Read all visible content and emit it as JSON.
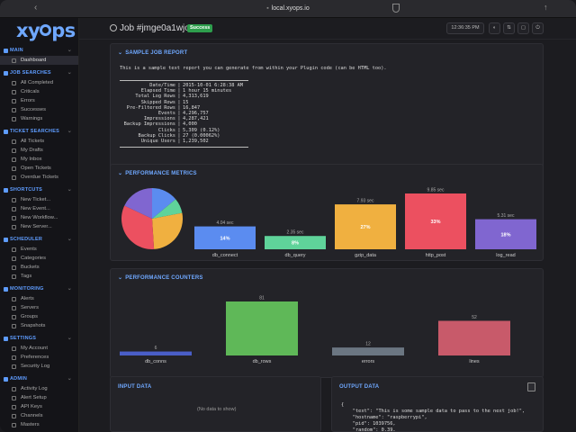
{
  "browser": {
    "url": "local.xyops.io"
  },
  "logo": {
    "prefix": "xy",
    "suffix": "ps"
  },
  "nav": [
    {
      "title": "MAIN",
      "items": [
        "Dashboard"
      ]
    },
    {
      "title": "JOB SEARCHES",
      "items": [
        "All Completed",
        "Criticals",
        "Errors",
        "Successes",
        "Warnings"
      ]
    },
    {
      "title": "TICKET SEARCHES",
      "items": [
        "All Tickets",
        "My Drafts",
        "My Inbox",
        "Open Tickets",
        "Overdue Tickets"
      ]
    },
    {
      "title": "SHORTCUTS",
      "items": [
        "New Ticket...",
        "New Event...",
        "New Workflow...",
        "New Server..."
      ]
    },
    {
      "title": "SCHEDULER",
      "items": [
        "Events",
        "Categories",
        "Buckets",
        "Tags"
      ]
    },
    {
      "title": "MONITORING",
      "items": [
        "Alerts",
        "Servers",
        "Groups",
        "Snapshots"
      ]
    },
    {
      "title": "SETTINGS",
      "items": [
        "My Account",
        "Preferences",
        "Security Log"
      ]
    },
    {
      "title": "ADMIN",
      "items": [
        "Activity Log",
        "Alert Setup",
        "API Keys",
        "Channels",
        "Masters"
      ]
    }
  ],
  "header": {
    "title": "Job #jmge0a1wjor",
    "status": "Success",
    "time": "12:36:35 PM"
  },
  "report": {
    "title": "SAMPLE JOB REPORT",
    "intro": "This is a sample text report you can generate from within your Plugin code (can be HTML too).",
    "rows": [
      {
        "key": "Date/Time",
        "value": "2015-10-01 6:28:38 AM"
      },
      {
        "key": "Elapsed Time",
        "value": "1 hour 15 minutes"
      },
      {
        "key": "Total Log Rows",
        "value": "4,313,619"
      },
      {
        "key": "Skipped Rows",
        "value": "15"
      },
      {
        "key": "Pre-Filtered Rows",
        "value": "16,847"
      },
      {
        "key": "Events",
        "value": "4,296,757"
      },
      {
        "key": "Impressions",
        "value": "4,287,421"
      },
      {
        "key": "Backup Impressions",
        "value": "4,000"
      },
      {
        "key": "Clicks",
        "value": "5,309 (0.12%)"
      },
      {
        "key": "Backup Clicks",
        "value": "27 (0.00062%)"
      },
      {
        "key": "Unique Users",
        "value": "1,239,502"
      }
    ]
  },
  "perf_metrics": {
    "title": "PERFORMANCE METRICS",
    "colors": [
      "#5b8cf0",
      "#5fd39a",
      "#f0b040",
      "#ec5060",
      "#8066d0"
    ]
  },
  "perf_counters": {
    "title": "PERFORMANCE COUNTERS"
  },
  "input_data": {
    "title": "INPUT DATA",
    "empty": "(No data to show)"
  },
  "output_data": {
    "title": "OUTPUT DATA",
    "lines": [
      "{",
      "    \"text\": \"This is some sample data to pass to the next job!\",",
      "    \"hostname\": \"raspberrypi\",",
      "    \"pid\": 1039756,",
      "    \"random\": 0.39,",
      "    \"obj\": {"
    ]
  },
  "chart_data": [
    {
      "type": "bar",
      "title": "PERFORMANCE METRICS",
      "categories": [
        "db_connect",
        "db_query",
        "gzip_data",
        "http_post",
        "log_read"
      ],
      "values": [
        4.04,
        2.35,
        7.93,
        9.85,
        5.31
      ],
      "value_labels": [
        "4.04 sec",
        "2.35 sec",
        "7.93 sec",
        "9.85 sec",
        "5.31 sec"
      ],
      "percent_labels": [
        "14%",
        "8%",
        "27%",
        "33%",
        "18%"
      ],
      "ylim": [
        0,
        9.85
      ],
      "grid": false
    },
    {
      "type": "pie",
      "categories": [
        "db_connect",
        "db_query",
        "gzip_data",
        "http_post",
        "log_read"
      ],
      "values": [
        14,
        8,
        27,
        33,
        18
      ]
    },
    {
      "type": "bar",
      "title": "PERFORMANCE COUNTERS",
      "categories": [
        "db_conns",
        "db_rows",
        "errors",
        "lines"
      ],
      "values": [
        6,
        81,
        12,
        52
      ],
      "colors": [
        "#4a5ec8",
        "#5fb858",
        "#6b7682",
        "#c85a6a"
      ],
      "ylim": [
        0,
        81
      ],
      "grid": false
    }
  ]
}
